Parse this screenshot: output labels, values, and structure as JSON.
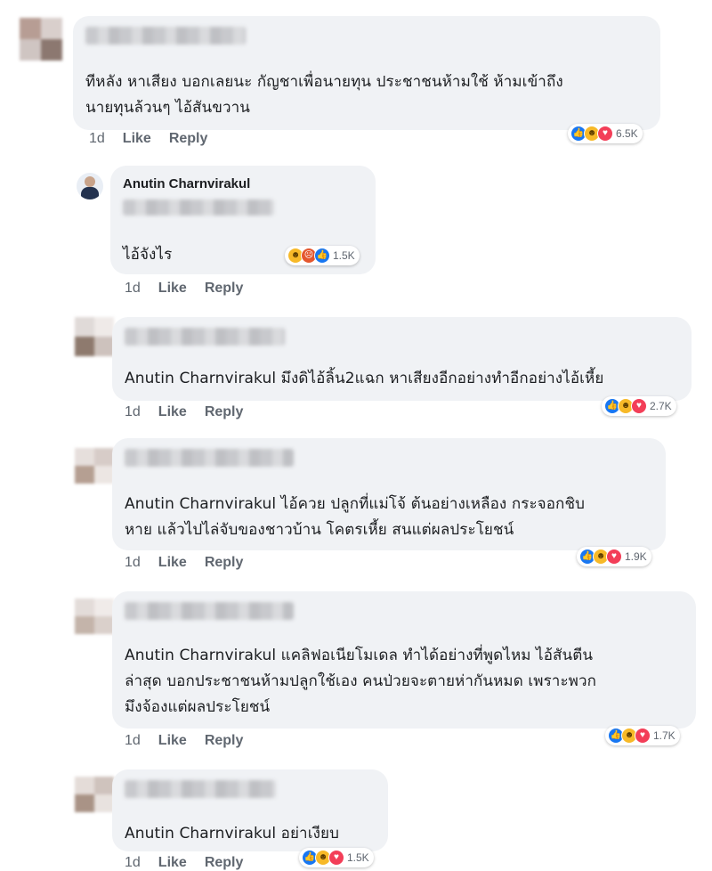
{
  "comments": [
    {
      "author": "",
      "text": "ทีหลัง หาเสียง บอกเลยนะ กัญชาเพื่อนายทุน ประชาชนห้ามใช้ ห้ามเข้าถึง\nนายทุนล้วนๆ ไอ้สันขวาน",
      "time": "1d",
      "like": "Like",
      "reply": "Reply",
      "reactions": [
        "like-icon",
        "haha-icon",
        "love-icon"
      ],
      "count": "6.5K"
    },
    {
      "author": "Anutin Charnvirakul",
      "text": "ไอ้จังไร",
      "time": "1d",
      "like": "Like",
      "reply": "Reply",
      "reactions": [
        "haha-icon",
        "angry-icon",
        "like-icon"
      ],
      "count": "1.5K"
    },
    {
      "author": "",
      "text": "Anutin Charnvirakul มึงดิไอ้ลิ้น2แฉก หาเสียงอีกอย่างทำอีกอย่างไอ้เหี้ย",
      "time": "1d",
      "like": "Like",
      "reply": "Reply",
      "reactions": [
        "like-icon",
        "haha-icon",
        "love-icon"
      ],
      "count": "2.7K"
    },
    {
      "author": "",
      "text": "Anutin Charnvirakul ไอ้ควย ปลูกที่แม่โจ้ ต้นอย่างเหลือง กระจอกชิบ\nหาย แล้วไปไล่จับของชาวบ้าน โคตรเหี้ย สนแต่ผลประโยชน์",
      "time": "1d",
      "like": "Like",
      "reply": "Reply",
      "reactions": [
        "like-icon",
        "haha-icon",
        "love-icon"
      ],
      "count": "1.9K"
    },
    {
      "author": "",
      "text": "Anutin Charnvirakul แคลิฟอเนียโมเดล  ทำได้อย่างที่พูดไหม ไอ้สันตีน\nล่าสุด บอกประชาชนห้ามปลูกใช้เอง  คนป่วยจะตายห่ากันหมด เพราะพวก\nมึงจ้องแต่ผลประโยชน์",
      "time": "1d",
      "like": "Like",
      "reply": "Reply",
      "reactions": [
        "like-icon",
        "haha-icon",
        "love-icon"
      ],
      "count": "1.7K"
    },
    {
      "author": "",
      "text": "Anutin Charnvirakul  อย่าเงียบ",
      "time": "1d",
      "like": "Like",
      "reply": "Reply",
      "reactions": [
        "like-icon",
        "haha-icon",
        "love-icon"
      ],
      "count": "1.5K"
    }
  ],
  "colors": {
    "bubble": "#f0f2f5",
    "like": "#1877f2",
    "haha": "#f7b928",
    "love": "#f33e58",
    "angry": "#e4572e"
  }
}
